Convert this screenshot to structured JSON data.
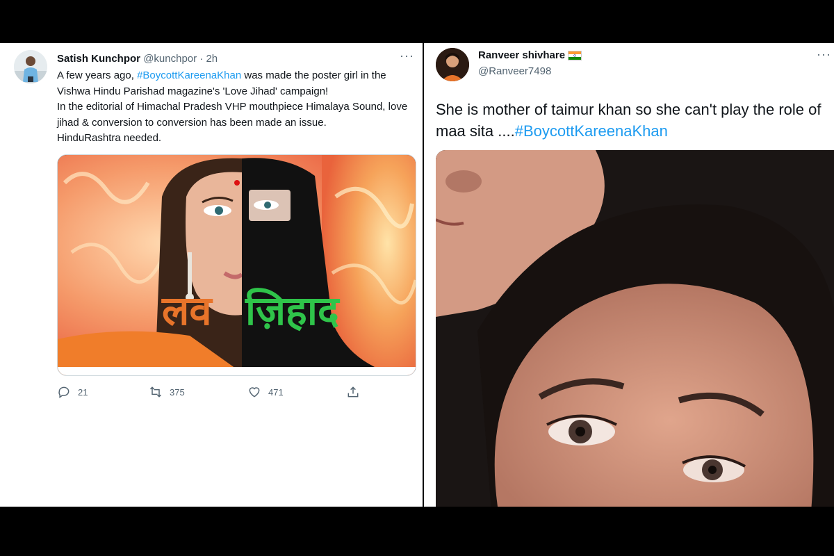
{
  "tweet_left": {
    "author_name": "Satish Kunchpor",
    "author_handle": "@kunchpor",
    "time": " · 2h",
    "more": "···",
    "text_line1_prefix": "A few years ago, ",
    "hashtag": "#BoycottKareenaKhan",
    "text_line1_suffix": " was made the poster girl in the Vishwa Hindu Parishad magazine's 'Love Jihad' campaign!",
    "text_line2": "In the editorial of Himachal Pradesh VHP mouthpiece Himalaya Sound, love jihad & conversion to conversion has been made an issue.",
    "text_line3": "HinduRashtra needed.",
    "media_caption_word1": "लव",
    "media_caption_word2": "ज़िहाद",
    "reply_count": "21",
    "retweet_count": "375",
    "like_count": "471"
  },
  "tweet_right": {
    "author_name": "Ranveer shivhare",
    "author_handle": "@Ranveer7498",
    "more": "···",
    "text_prefix": "She is mother of taimur khan so she can't play the role of maa sita ....",
    "hashtag": "#BoycottKareenaKhan"
  },
  "colors": {
    "hashtag": "#1d9bf0",
    "muted": "#536471",
    "text": "#0f1419",
    "caption_orange": "#e8742a",
    "caption_green": "#2fc44a"
  }
}
